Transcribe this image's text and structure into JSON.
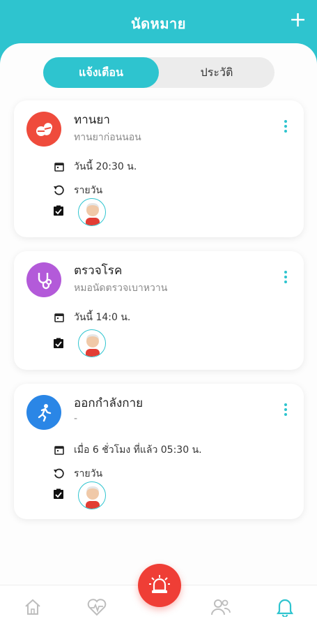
{
  "header": {
    "title": "นัดหมาย",
    "add_label": "+"
  },
  "tabs": {
    "active": "แจ้งเตือน",
    "inactive": "ประวัติ"
  },
  "colors": {
    "accent": "#2ec4cf",
    "medicine": "#ef4b3c",
    "checkup": "#b35ad9",
    "exercise": "#2a86e6",
    "sos": "#ef3e36"
  },
  "cards": [
    {
      "title": "ทานยา",
      "subtitle": "ทานยาก่อนนอน",
      "time": "วันนี้ 20:30 น.",
      "repeat": "รายวัน",
      "icon": "pills-icon"
    },
    {
      "title": "ตรวจโรค",
      "subtitle": "หมอนัดตรวจเบาหวาน",
      "time": "วันนี้ 14:0 น.",
      "repeat": "",
      "icon": "stethoscope-icon"
    },
    {
      "title": "ออกกำลังกาย",
      "subtitle": "-",
      "time": "เมื่อ 6 ชั่วโมง ที่แล้ว 05:30 น.",
      "repeat": "รายวัน",
      "icon": "running-icon"
    }
  ],
  "nav": [
    {
      "name": "home-icon",
      "active": false
    },
    {
      "name": "heart-rate-icon",
      "active": false
    },
    {
      "name": "siren-icon",
      "active": false
    },
    {
      "name": "people-icon",
      "active": false
    },
    {
      "name": "bell-icon",
      "active": true
    }
  ]
}
